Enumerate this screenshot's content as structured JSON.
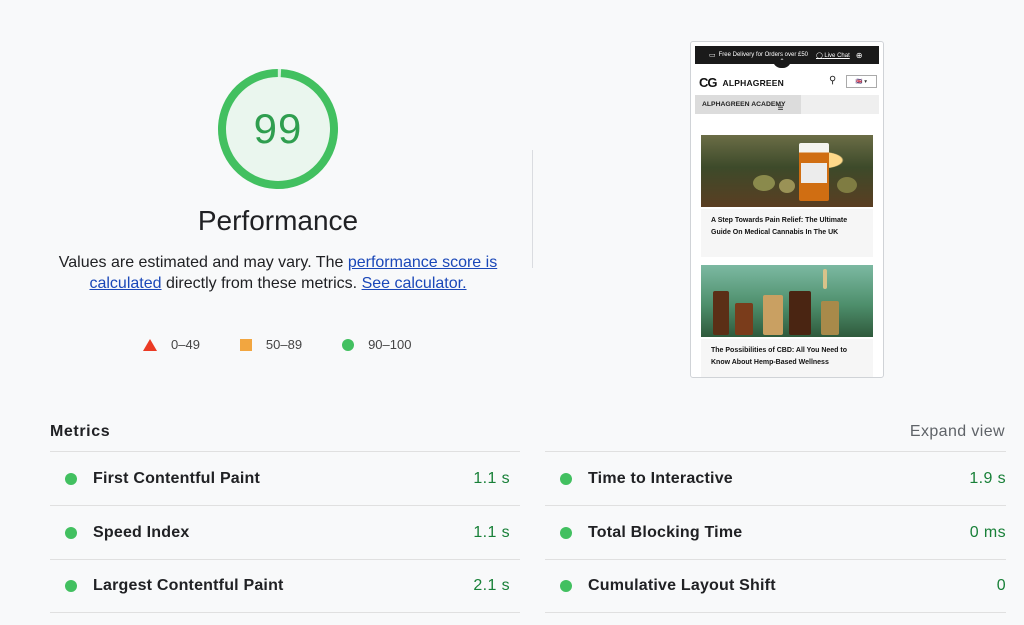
{
  "score": {
    "value": "99",
    "fraction": 0.99,
    "color": "#42c060"
  },
  "performance": {
    "title": "Performance",
    "desc_prefix": "Values are estimated and may vary. The ",
    "link1": "performance score is calculated",
    "desc_mid": " directly from these metrics. ",
    "link2": "See calculator."
  },
  "legend": [
    {
      "shape": "triangle",
      "range": "0–49",
      "color": "#eb3a24"
    },
    {
      "shape": "square",
      "range": "50–89",
      "color": "#f2a640"
    },
    {
      "shape": "circle",
      "range": "90–100",
      "color": "#42c060"
    }
  ],
  "screenshot": {
    "topbar": "Free Delivery for Orders over £50",
    "live_chat": "Live Chat",
    "brand": "ALPHAGREEN",
    "flag": "🇬🇧 ▾",
    "nav": "ALPHAGREEN ACADEMY",
    "articles": [
      {
        "title": "A Step Towards Pain Relief: The Ultimate Guide On Medical Cannabis In The UK"
      },
      {
        "title": "The Possibilities of CBD: All You Need to Know About Hemp-Based Wellness"
      }
    ]
  },
  "metrics": {
    "title": "Metrics",
    "expand_label": "Expand view",
    "left": [
      {
        "name": "First Contentful Paint",
        "value": "1.1 s"
      },
      {
        "name": "Speed Index",
        "value": "1.1 s"
      },
      {
        "name": "Largest Contentful Paint",
        "value": "2.1 s"
      }
    ],
    "right": [
      {
        "name": "Time to Interactive",
        "value": "1.9 s"
      },
      {
        "name": "Total Blocking Time",
        "value": "0 ms"
      },
      {
        "name": "Cumulative Layout Shift",
        "value": "0"
      }
    ]
  }
}
